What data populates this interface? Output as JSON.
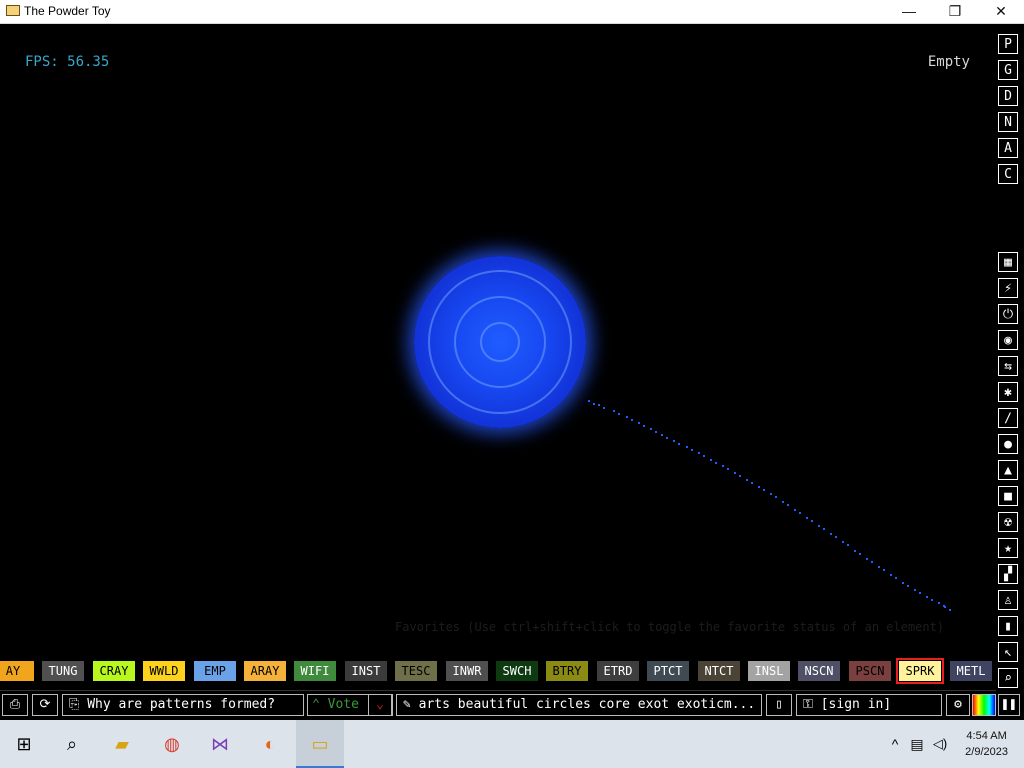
{
  "window": {
    "title": "The Powder Toy",
    "minimize": "—",
    "maximize": "❐",
    "close": "✕"
  },
  "hud": {
    "fps": "FPS: 56.35",
    "hover_element": "Empty"
  },
  "favorites_hint": "Favorites (Use ctrl+shift+click to toggle the favorite status of an element)",
  "sidebar_top": [
    "P",
    "G",
    "D",
    "N",
    "A",
    "C"
  ],
  "sidebar_icons": [
    "wall-icon",
    "electronics-icon",
    "power-icon",
    "sensor-icon",
    "force-icon",
    "explosive-icon",
    "gas-icon",
    "liquid-icon",
    "powder-icon",
    "solid-icon",
    "radioactive-icon",
    "special-icon",
    "life-icon",
    "tools-icon",
    "favorites-icon",
    "pointer-icon",
    "search-icon"
  ],
  "elements": [
    {
      "label": "AY",
      "bg": "#f1a51d",
      "fg": "#000000"
    },
    {
      "label": "TUNG",
      "bg": "#505050",
      "fg": "#ffffff"
    },
    {
      "label": "CRAY",
      "bg": "#b8f81e",
      "fg": "#000000"
    },
    {
      "label": "WWLD",
      "bg": "#fcd21c",
      "fg": "#000000"
    },
    {
      "label": "EMP",
      "bg": "#6aa2ea",
      "fg": "#000000"
    },
    {
      "label": "ARAY",
      "bg": "#f5b23a",
      "fg": "#000000"
    },
    {
      "label": "WIFI",
      "bg": "#3f8a3c",
      "fg": "#ffffff"
    },
    {
      "label": "INST",
      "bg": "#3b3b3b",
      "fg": "#ffffff"
    },
    {
      "label": "TESC",
      "bg": "#6f6f4a",
      "fg": "#000000"
    },
    {
      "label": "INWR",
      "bg": "#4f4f4f",
      "fg": "#ffffff"
    },
    {
      "label": "SWCH",
      "bg": "#0d3a10",
      "fg": "#ffffff"
    },
    {
      "label": "BTRY",
      "bg": "#8a8a15",
      "fg": "#000000"
    },
    {
      "label": "ETRD",
      "bg": "#3e3e3e",
      "fg": "#ffffff"
    },
    {
      "label": "PTCT",
      "bg": "#3f4a52",
      "fg": "#ffffff"
    },
    {
      "label": "NTCT",
      "bg": "#4b4436",
      "fg": "#ffffff"
    },
    {
      "label": "INSL",
      "bg": "#a3a3a3",
      "fg": "#ffffff"
    },
    {
      "label": "NSCN",
      "bg": "#4f4f66",
      "fg": "#ffffff"
    },
    {
      "label": "PSCN",
      "bg": "#7a3f3f",
      "fg": "#000000"
    },
    {
      "label": "SPRK",
      "bg": "#fff29b",
      "fg": "#000000"
    },
    {
      "label": "METL",
      "bg": "#3f4460",
      "fg": "#ffffff"
    }
  ],
  "selected_element": "SPRK",
  "bottombar": {
    "save_title": "Why are patterns formed?",
    "vote_label": "Vote",
    "tags": "arts beautiful circles core exot exoticm...",
    "sign_in": "[sign in]"
  },
  "taskbar": {
    "time": "4:54 AM",
    "date": "2/9/2023",
    "tray": [
      "^",
      "▤",
      "◁)"
    ]
  },
  "colors": {
    "particle": "#1f5dff",
    "fps": "#3aa7c9",
    "selection": "#e82020"
  }
}
